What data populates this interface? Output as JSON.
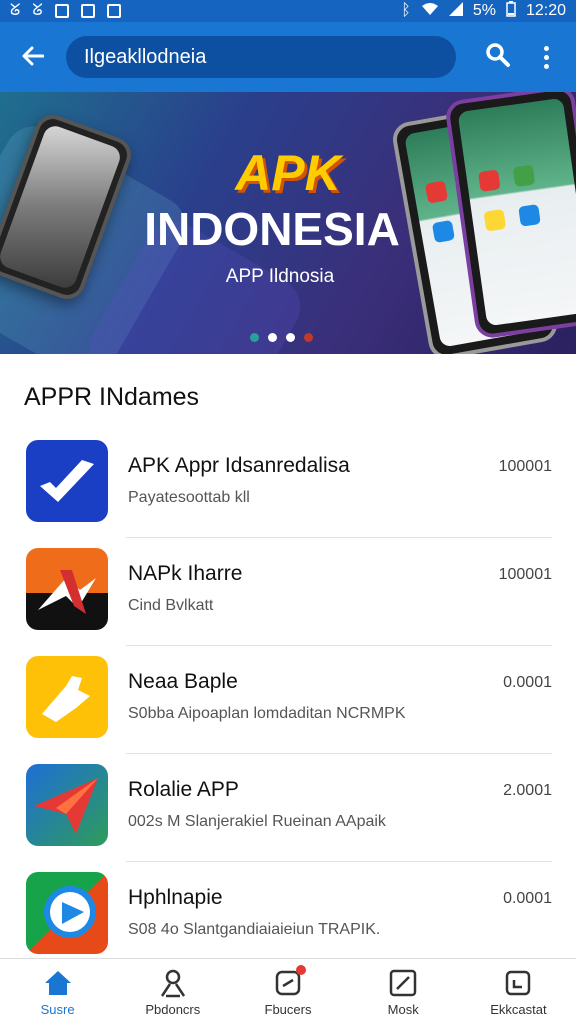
{
  "status_bar": {
    "left_icons": [
      "g-icon",
      "g-icon",
      "image-icon",
      "image-icon",
      "image-icon"
    ],
    "battery": "5%",
    "time": "12:20"
  },
  "app_bar": {
    "search_value": "Ilgeakllodneia",
    "back_icon": "back-arrow-icon",
    "search_icon": "search-icon",
    "more_icon": "more-vert-icon"
  },
  "banner": {
    "logo_text": "APK",
    "title": "INDONESIA",
    "subtitle": "APP Ildnosia",
    "active_dot": 0
  },
  "section": {
    "title": "APPR INdames"
  },
  "apps": [
    {
      "name": "APK Appr Idsanredalisa",
      "subtitle": "Payatesoottab kll",
      "count": "100001",
      "icon": "blue-check-icon",
      "color": "#1a3fc4"
    },
    {
      "name": "NAPk Iharre",
      "subtitle": "Cind Bvlkatt",
      "count": "100001",
      "icon": "orange-star-icon",
      "color": "#ef6c1a"
    },
    {
      "name": "Neaa Baple",
      "subtitle": "S0bba Aipoaplan lomdaditan NCRMPK",
      "count": "0.0001",
      "icon": "yellow-hand-icon",
      "color": "#ffc107"
    },
    {
      "name": "Rolalie APP",
      "subtitle": "002s M Slanjerakiel Rueinan AApaik",
      "count": "2.0001",
      "icon": "paper-plane-icon",
      "color": "#1e6fd6"
    },
    {
      "name": "Hphlnapie",
      "subtitle": "S08 4o Slantgandiaiaieiun TRAPIK.",
      "count": "0.0001",
      "icon": "chat-bubble-icon",
      "color": "#16a34a"
    }
  ],
  "bottom_nav": [
    {
      "label": "Susre",
      "icon": "home-icon"
    },
    {
      "label": "Pbdoncrs",
      "icon": "person-icon"
    },
    {
      "label": "Fbucers",
      "icon": "download-icon"
    },
    {
      "label": "Mosk",
      "icon": "edit-icon"
    },
    {
      "label": "Ekkcastat",
      "icon": "calendar-icon"
    }
  ],
  "colors": {
    "primary": "#1976d2",
    "status_bar": "#1565c0",
    "search_box": "#0d4fa0"
  }
}
